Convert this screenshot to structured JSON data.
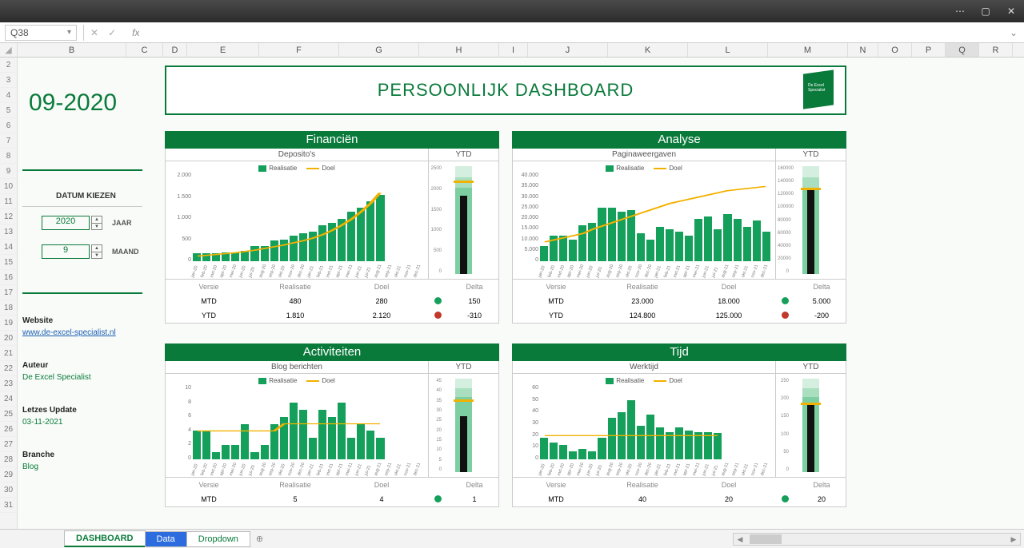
{
  "window": {
    "min": "—",
    "max": "▢",
    "close": "✕",
    "more": "⋯"
  },
  "namebox": "Q38",
  "fx": {
    "cancel": "✕",
    "enter": "✓",
    "label": "fx",
    "value": "",
    "expand": "⌄"
  },
  "columns": [
    "B",
    "C",
    "D",
    "E",
    "F",
    "G",
    "H",
    "I",
    "J",
    "K",
    "L",
    "M",
    "N",
    "O",
    "P",
    "Q",
    "R"
  ],
  "rows": [
    "2",
    "3",
    "4",
    "5",
    "6",
    "7",
    "8",
    "9",
    "10",
    "11",
    "12",
    "13",
    "14",
    "15",
    "16",
    "17",
    "18",
    "19",
    "20",
    "21",
    "22",
    "23",
    "24",
    "25",
    "26",
    "27",
    "28",
    "29",
    "30",
    "31"
  ],
  "sidebar": {
    "period": "09-2020",
    "datum_label": "DATUM KIEZEN",
    "year": "2020",
    "year_label": "JAAR",
    "month": "9",
    "month_label": "MAAND",
    "website_hdr": "Website",
    "website": "www.de-excel-specialist.nl",
    "author_hdr": "Auteur",
    "author": "De Excel Specialist",
    "update_hdr": "Letzes Update",
    "update": "03-11-2021",
    "branche_hdr": "Branche",
    "branche": "Blog"
  },
  "header_title": "PERSOONLIJK DASHBOARD",
  "logo_text": "De Excel Specialist",
  "legend": {
    "real": "Realisatie",
    "doel": "Doel"
  },
  "meta_headers": {
    "versie": "Versie",
    "real": "Realisatie",
    "doel": "Doel",
    "delta": "Delta",
    "mtd": "MTD",
    "ytd": "YTD"
  },
  "ytd_label": "YTD",
  "xlabels": [
    "jan-20",
    "feb-20",
    "mrt-20",
    "apr-20",
    "mei-20",
    "jun-20",
    "jul-20",
    "aug-20",
    "sep-20",
    "okt-20",
    "nov-20",
    "dec-20",
    "jan-21",
    "feb-21",
    "mrt-21",
    "apr-21",
    "mei-21",
    "jun-21",
    "jul-21",
    "aug-21",
    "sep-21",
    "okt-21",
    "nov-21",
    "dec-21"
  ],
  "panels": {
    "fin": {
      "title": "Financiën",
      "sub": "Deposito's",
      "mtd": {
        "real": "480",
        "doel": "280",
        "dot": "#14a05a",
        "delta": "150"
      },
      "ytd": {
        "real": "1.810",
        "doel": "2.120",
        "dot": "#c0392b",
        "delta": "-310"
      }
    },
    "ana": {
      "title": "Analyse",
      "sub": "Paginaweergaven",
      "mtd": {
        "real": "23.000",
        "doel": "18.000",
        "dot": "#14a05a",
        "delta": "5.000"
      },
      "ytd": {
        "real": "124.800",
        "doel": "125.000",
        "dot": "#c0392b",
        "delta": "-200"
      }
    },
    "act": {
      "title": "Activiteiten",
      "sub": "Blog berichten",
      "mtd": {
        "real": "5",
        "doel": "4",
        "dot": "#14a05a",
        "delta": "1"
      }
    },
    "tijd": {
      "title": "Tijd",
      "sub": "Werktijd",
      "mtd": {
        "real": "40",
        "doel": "20",
        "dot": "#14a05a",
        "delta": "20"
      }
    }
  },
  "chart_data": [
    {
      "id": "fin",
      "type": "bar",
      "ylim": [
        0,
        2000
      ],
      "yticks": [
        "2.000",
        "1.500",
        "1.000",
        "500",
        "0"
      ],
      "values": [
        180,
        180,
        180,
        200,
        200,
        250,
        350,
        350,
        480,
        500,
        600,
        650,
        700,
        850,
        900,
        1000,
        1150,
        1250,
        1400,
        1550,
        null,
        null,
        null,
        null
      ],
      "doel": [
        120,
        140,
        160,
        180,
        200,
        230,
        260,
        300,
        340,
        380,
        430,
        480,
        540,
        620,
        720,
        840,
        980,
        1150,
        1350,
        1600,
        null,
        null,
        null,
        null
      ],
      "ytd": {
        "ylim": [
          0,
          2500
        ],
        "yticks": [
          "2500",
          "2000",
          "1500",
          "1000",
          "500",
          "0"
        ],
        "bar": 1810,
        "marker": 2120
      }
    },
    {
      "id": "ana",
      "type": "bar",
      "ylim": [
        0,
        40000
      ],
      "yticks": [
        "40.000",
        "35.000",
        "30.000",
        "25.000",
        "20.000",
        "15.000",
        "10.000",
        "5.000",
        "0"
      ],
      "values": [
        7000,
        12000,
        12000,
        10000,
        17000,
        18000,
        25000,
        25000,
        23000,
        24000,
        13000,
        10000,
        16000,
        15000,
        14000,
        12000,
        20000,
        21000,
        15000,
        22000,
        20000,
        16000,
        19000,
        14000
      ],
      "doel": [
        9000,
        10000,
        11000,
        12000,
        13000,
        15000,
        16500,
        18000,
        19500,
        21000,
        22500,
        24000,
        25500,
        27000,
        28000,
        29000,
        30000,
        31000,
        32000,
        33000,
        33500,
        34000,
        34500,
        35000
      ],
      "ytd": {
        "ylim": [
          0,
          160000
        ],
        "yticks": [
          "160000",
          "140000",
          "120000",
          "100000",
          "80000",
          "60000",
          "40000",
          "20000",
          "0"
        ],
        "bar": 124800,
        "marker": 125000
      }
    },
    {
      "id": "act",
      "type": "bar",
      "ylim": [
        0,
        10
      ],
      "yticks": [
        "10",
        "8",
        "6",
        "4",
        "2",
        "0"
      ],
      "values": [
        4,
        4,
        1,
        2,
        2,
        5,
        1,
        2,
        5,
        6,
        8,
        7,
        3,
        7,
        6,
        8,
        3,
        5,
        4,
        3,
        null,
        null,
        null,
        null
      ],
      "doel": [
        4,
        4,
        4,
        4,
        4,
        4,
        4,
        4,
        4,
        5,
        5,
        5,
        5,
        5,
        5,
        5,
        5,
        5,
        5,
        5,
        null,
        null,
        null,
        null
      ],
      "ytd": {
        "ylim": [
          0,
          45
        ],
        "yticks": [
          "45",
          "40",
          "35",
          "30",
          "25",
          "20",
          "15",
          "10",
          "5",
          "0"
        ],
        "bar": 27,
        "marker": 34
      }
    },
    {
      "id": "tijd",
      "type": "bar",
      "ylim": [
        0,
        60
      ],
      "yticks": [
        "60",
        "50",
        "40",
        "30",
        "20",
        "10",
        "0"
      ],
      "values": [
        18,
        14,
        12,
        7,
        9,
        7,
        18,
        35,
        40,
        50,
        28,
        38,
        27,
        23,
        27,
        24,
        23,
        23,
        22,
        null,
        null,
        null,
        null,
        null
      ],
      "doel": [
        20,
        20,
        20,
        20,
        20,
        20,
        20,
        20,
        20,
        20,
        20,
        20,
        20,
        20,
        20,
        20,
        20,
        20,
        20,
        null,
        null,
        null,
        null,
        null
      ],
      "ytd": {
        "ylim": [
          0,
          250
        ],
        "yticks": [
          "250",
          "200",
          "150",
          "100",
          "50",
          "0"
        ],
        "bar": 180,
        "marker": 180
      }
    }
  ],
  "tabs": {
    "items": [
      "DASHBOARD",
      "Data",
      "Dropdown"
    ],
    "active": 0
  }
}
